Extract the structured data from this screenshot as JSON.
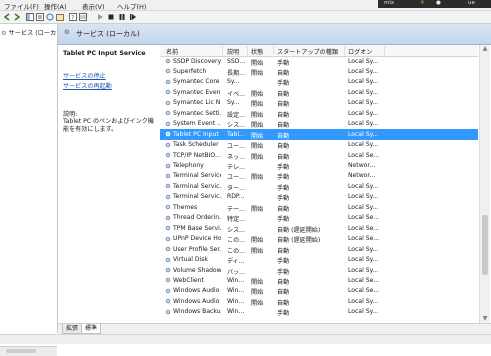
{
  "menu": [
    "ファイル(F)",
    "操作(A)",
    "表示(V)",
    "ヘルプ(H)"
  ],
  "tray": {
    "text": "mix",
    "user": "ue"
  },
  "toolbar_icons": [
    "back-icon",
    "forward-icon",
    "console-tree-icon",
    "properties-icon",
    "refresh-icon",
    "export-icon",
    "help-icon",
    "start-icon",
    "stop-icon",
    "pause-icon",
    "restart-icon"
  ],
  "tree": {
    "item": "サービス (ローカ"
  },
  "header": {
    "title": "サービス (ローカル)"
  },
  "description_pane": {
    "service_name": "Tablet PC Input Service",
    "stop_link": "サービスの停止",
    "restart_link": "サービスの再起動",
    "desc_label": "説明:",
    "desc_text": "Tablet PC のペンおよびインク機能を有効にします。"
  },
  "columns": [
    "名前",
    "説明",
    "状態",
    "スタートアップの種類",
    "ログオン"
  ],
  "rows": [
    {
      "name": "SSDP Discovery",
      "desc": "SSD...",
      "status": "開始",
      "startup": "手動",
      "logon": "Local Sy..."
    },
    {
      "name": "Superfetch",
      "desc": "長期...",
      "status": "開始",
      "startup": "自動",
      "logon": "Local Sy..."
    },
    {
      "name": "Symantec Core ...",
      "desc": "Sy...",
      "status": "",
      "startup": "手動",
      "logon": "Local Sy..."
    },
    {
      "name": "Symantec Even...",
      "desc": "イベ...",
      "status": "開始",
      "startup": "自動",
      "logon": "Local Sy..."
    },
    {
      "name": "Symantec Lic N...",
      "desc": "Sy...",
      "status": "開始",
      "startup": "自動",
      "logon": "Local Sy..."
    },
    {
      "name": "Symantec Setti...",
      "desc": "設定...",
      "status": "開始",
      "startup": "自動",
      "logon": "Local Sy..."
    },
    {
      "name": "System Event ...",
      "desc": "シス...",
      "status": "開始",
      "startup": "自動",
      "logon": "Local Sy..."
    },
    {
      "name": "Tablet PC Input ...",
      "desc": "Tabl...",
      "status": "開始",
      "startup": "自動",
      "logon": "Local Sy...",
      "selected": true
    },
    {
      "name": "Task Scheduler",
      "desc": "ユー...",
      "status": "開始",
      "startup": "自動",
      "logon": "Local Sy..."
    },
    {
      "name": "TCP/IP NetBIO...",
      "desc": "ネッ...",
      "status": "開始",
      "startup": "自動",
      "logon": "Local Se..."
    },
    {
      "name": "Telephony",
      "desc": "テレ...",
      "status": "",
      "startup": "手動",
      "logon": "Networ..."
    },
    {
      "name": "Terminal Services",
      "desc": "ユー...",
      "status": "開始",
      "startup": "手動",
      "logon": "Networ..."
    },
    {
      "name": "Terminal Servic...",
      "desc": "ター...",
      "status": "",
      "startup": "手動",
      "logon": "Local Sy..."
    },
    {
      "name": "Terminal Servic...",
      "desc": "RDP...",
      "status": "",
      "startup": "手動",
      "logon": "Local Sy..."
    },
    {
      "name": "Themes",
      "desc": "テー...",
      "status": "開始",
      "startup": "自動",
      "logon": "Local Sy..."
    },
    {
      "name": "Thread Orderin...",
      "desc": "特定...",
      "status": "",
      "startup": "手動",
      "logon": "Local Se..."
    },
    {
      "name": "TPM Base Servi...",
      "desc": "シス...",
      "status": "",
      "startup": "自動 (遅延開始)",
      "logon": "Local Se..."
    },
    {
      "name": "UPnP Device Host",
      "desc": "この...",
      "status": "開始",
      "startup": "自動 (遅延開始)",
      "logon": "Local Se..."
    },
    {
      "name": "User Profile Ser...",
      "desc": "この...",
      "status": "開始",
      "startup": "自動",
      "logon": "Local Sy..."
    },
    {
      "name": "Virtual Disk",
      "desc": "ディ...",
      "status": "",
      "startup": "手動",
      "logon": "Local Sy..."
    },
    {
      "name": "Volume Shadow...",
      "desc": "バッ...",
      "status": "",
      "startup": "手動",
      "logon": "Local Sy..."
    },
    {
      "name": "WebClient",
      "desc": "Win...",
      "status": "開始",
      "startup": "自動",
      "logon": "Local Se..."
    },
    {
      "name": "Windows Audio",
      "desc": "Win...",
      "status": "開始",
      "startup": "自動",
      "logon": "Local Se..."
    },
    {
      "name": "Windows Audio ...",
      "desc": "Win...",
      "status": "開始",
      "startup": "自動",
      "logon": "Local Sy..."
    },
    {
      "name": "Windows Backup",
      "desc": "Win...",
      "status": "",
      "startup": "手動",
      "logon": "Local Sy..."
    }
  ],
  "tabs": [
    "拡張",
    "標準"
  ],
  "colors": {
    "selection": "#3399ff",
    "link": "#1e56b4",
    "header_band": "#c4d6ec"
  }
}
